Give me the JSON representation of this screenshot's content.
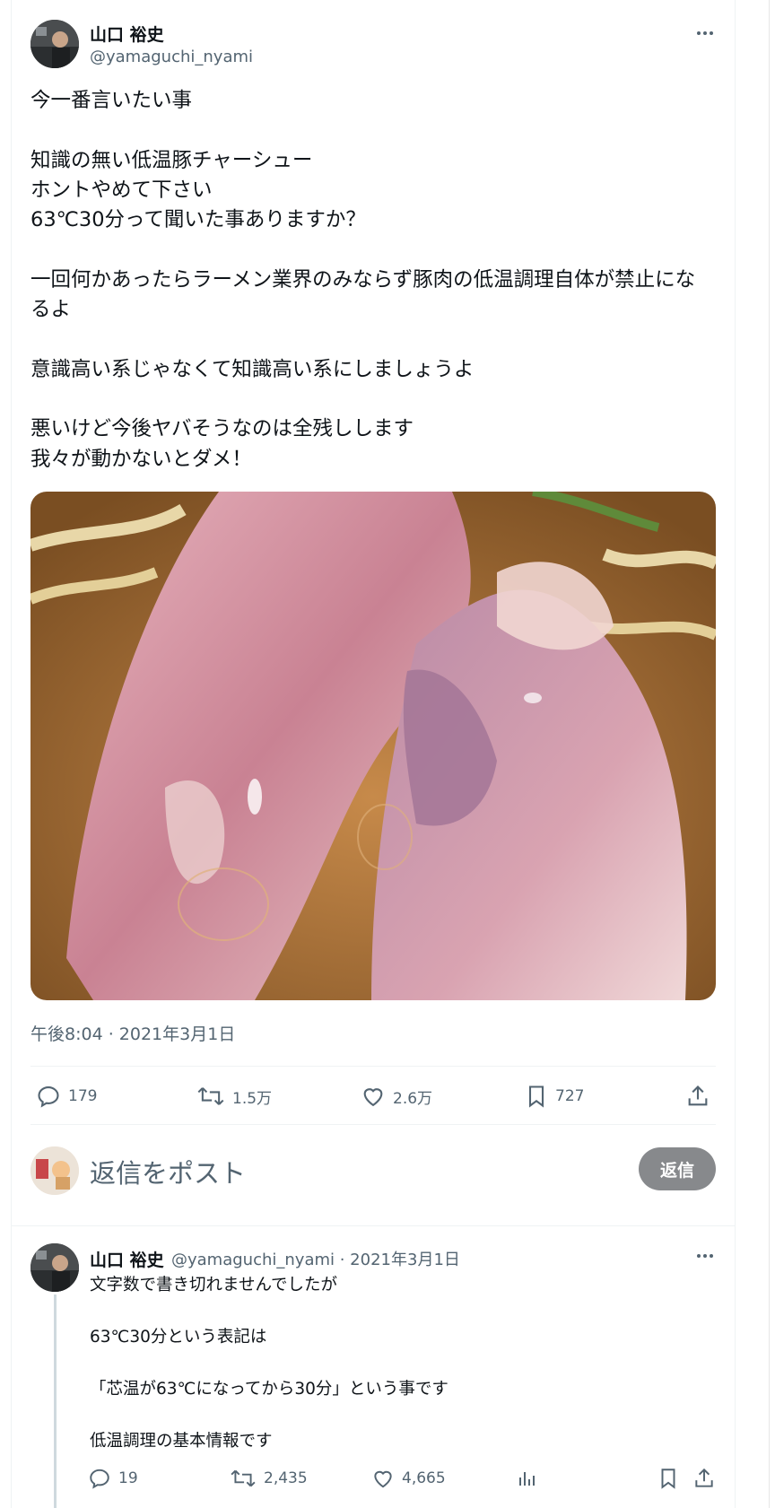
{
  "tweet": {
    "author_name": "山口 裕史",
    "author_handle": "@yamaguchi_nyami",
    "text_lines": [
      "今一番言いたい事",
      "",
      "知識の無い低温豚チャーシュー",
      "ホントやめて下さい",
      "63℃30分って聞いた事ありますか？",
      "",
      "一回何かあったらラーメン業界のみならず豚肉の低温調理自体が禁止にな",
      "るよ",
      "",
      "意識高い系じゃなくて知識高い系にしましょうよ",
      "",
      "悪いけど今後ヤバそうなのは全残しします",
      "我々が動かないとダメ！"
    ],
    "timestamp": "午後8:04 · 2021年3月1日",
    "stats": {
      "replies": "179",
      "retweets": "1.5万",
      "likes": "2.6万",
      "bookmarks": "727"
    }
  },
  "reply_box": {
    "placeholder": "返信をポスト",
    "button_label": "返信"
  },
  "reply": {
    "author_name": "山口 裕史",
    "meta": "@yamaguchi_nyami · 2021年3月1日",
    "text_lines": [
      "文字数で書き切れませんでしたが",
      "",
      "63℃30分という表記は",
      "",
      "「芯温が63℃になってから30分」という事です",
      "",
      "低温調理の基本情報です"
    ],
    "stats": {
      "replies": "19",
      "retweets": "2,435",
      "likes": "4,665"
    }
  },
  "icons": [
    "more-icon",
    "reply-icon",
    "retweet-icon",
    "like-icon",
    "bookmark-icon",
    "share-icon",
    "views-icon"
  ],
  "colors": {
    "text": "#0f1419",
    "secondary": "#536471",
    "divider": "#eff3f4",
    "reply_button": "#87898c"
  }
}
